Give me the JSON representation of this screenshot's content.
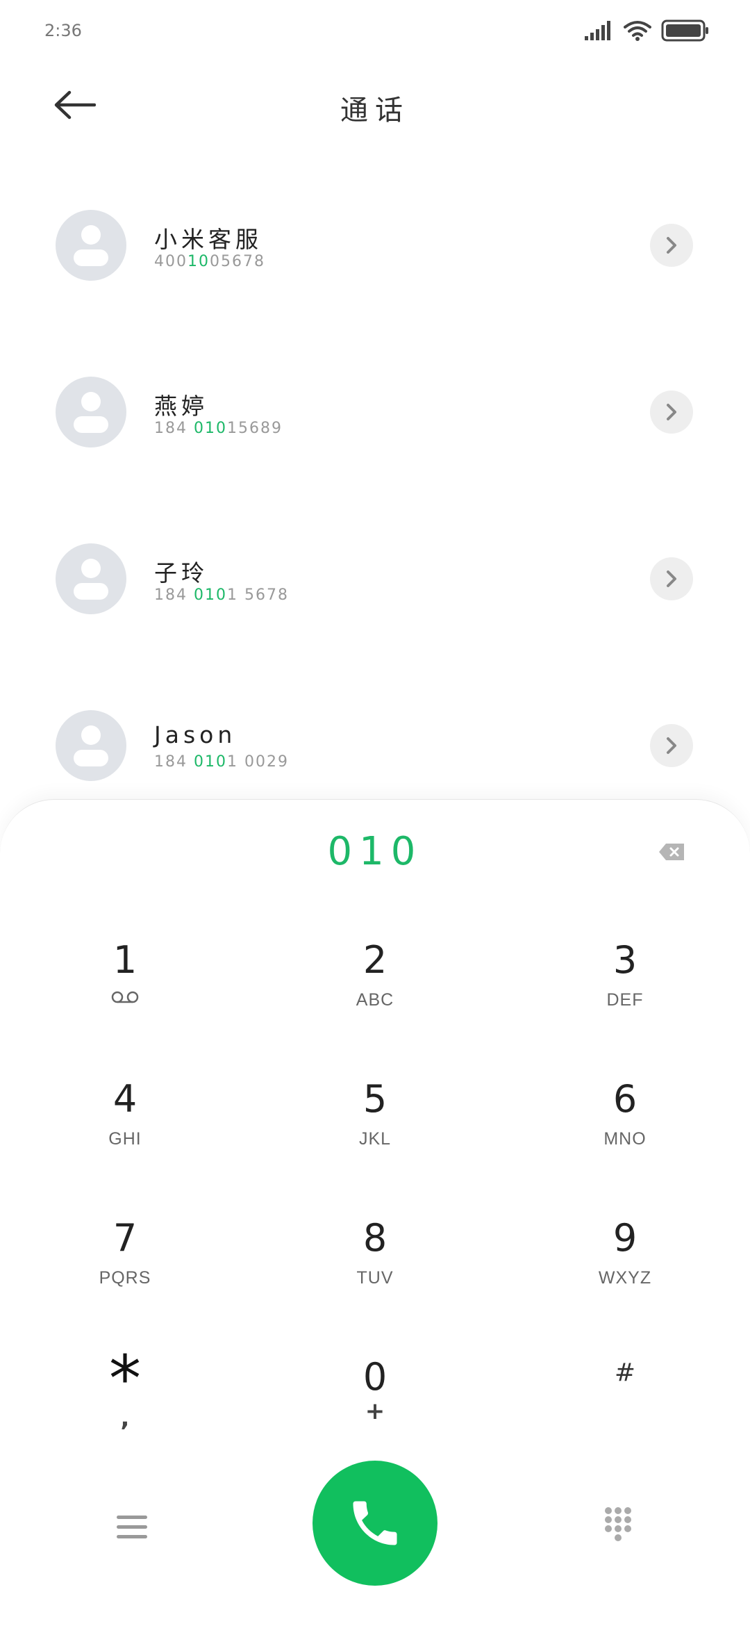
{
  "status_bar": {
    "time": "2:36",
    "icons": [
      "signal-icon",
      "wifi-icon",
      "battery-icon"
    ]
  },
  "header": {
    "title": "通话",
    "back_icon": "arrow-left-icon"
  },
  "contacts": [
    {
      "name": "小米客服",
      "number_parts": [
        {
          "text": "400",
          "hl": false
        },
        {
          "text": "10",
          "hl": true
        },
        {
          "text": "05678",
          "hl": false
        }
      ]
    },
    {
      "name": "燕婷",
      "number_parts": [
        {
          "text": "184 ",
          "hl": false
        },
        {
          "text": "010",
          "hl": true
        },
        {
          "text": "15689",
          "hl": false
        }
      ]
    },
    {
      "name": "子玲",
      "number_parts": [
        {
          "text": "184 ",
          "hl": false
        },
        {
          "text": "010",
          "hl": true
        },
        {
          "text": "1 5678",
          "hl": false
        }
      ]
    },
    {
      "name": "Jason",
      "number_parts": [
        {
          "text": "184 ",
          "hl": false
        },
        {
          "text": "010",
          "hl": true
        },
        {
          "text": "1 0029",
          "hl": false
        }
      ]
    }
  ],
  "dialer": {
    "input_value": "010",
    "backspace_icon": "backspace-icon"
  },
  "keypad": [
    {
      "digit": "1",
      "sub": "",
      "sub_icon": "voicemail-icon"
    },
    {
      "digit": "2",
      "sub": "ABC"
    },
    {
      "digit": "3",
      "sub": "DEF"
    },
    {
      "digit": "4",
      "sub": "GHI"
    },
    {
      "digit": "5",
      "sub": "JKL"
    },
    {
      "digit": "6",
      "sub": "MNO"
    },
    {
      "digit": "7",
      "sub": "PQRS"
    },
    {
      "digit": "8",
      "sub": "TUV"
    },
    {
      "digit": "9",
      "sub": "WXYZ"
    },
    {
      "digit": "*",
      "sub": ","
    },
    {
      "digit": "0",
      "sub": "+"
    },
    {
      "digit": "#",
      "sub": ""
    }
  ],
  "bottom_bar": {
    "menu_icon": "menu-icon",
    "call_icon": "phone-icon",
    "keypad_icon": "dialpad-icon"
  },
  "colors": {
    "accent": "#1db868",
    "call_button": "#11bf5e",
    "avatar_bg": "#e0e3e8"
  }
}
